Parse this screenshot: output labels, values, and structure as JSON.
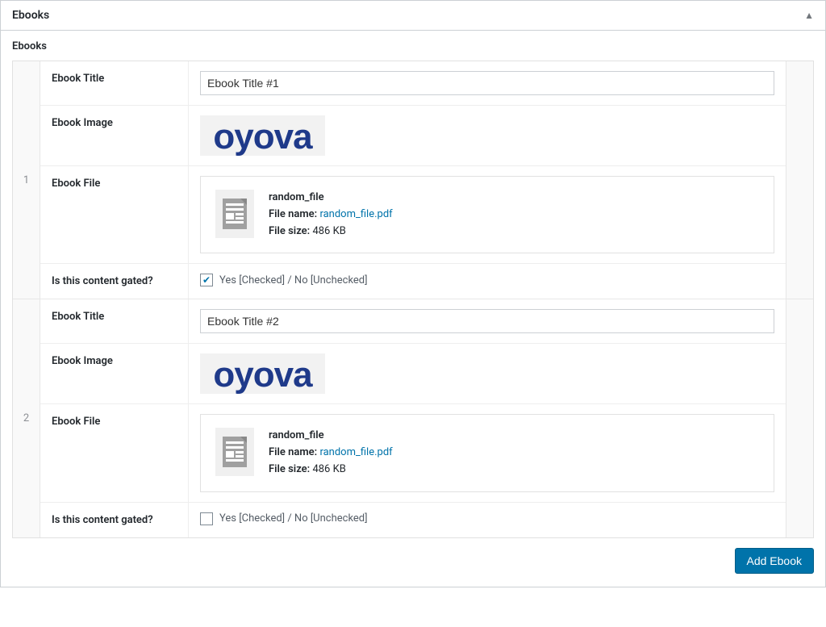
{
  "panel": {
    "title": "Ebooks",
    "section_label": "Ebooks",
    "add_button": "Add Ebook",
    "labels": {
      "ebook_title": "Ebook Title",
      "ebook_image": "Ebook Image",
      "ebook_file": "Ebook File",
      "gated": "Is this content gated?",
      "file_name": "File name:",
      "file_size": "File size:",
      "checkbox_hint": "Yes [Checked] / No [Unchecked]"
    }
  },
  "rows": [
    {
      "index": "1",
      "title": "Ebook Title #1",
      "image_text": "oyova",
      "file": {
        "title": "random_file",
        "name": "random_file.pdf",
        "size": "486 KB"
      },
      "gated": true
    },
    {
      "index": "2",
      "title": "Ebook Title #2",
      "image_text": "oyova",
      "file": {
        "title": "random_file",
        "name": "random_file.pdf",
        "size": "486 KB"
      },
      "gated": false
    }
  ]
}
